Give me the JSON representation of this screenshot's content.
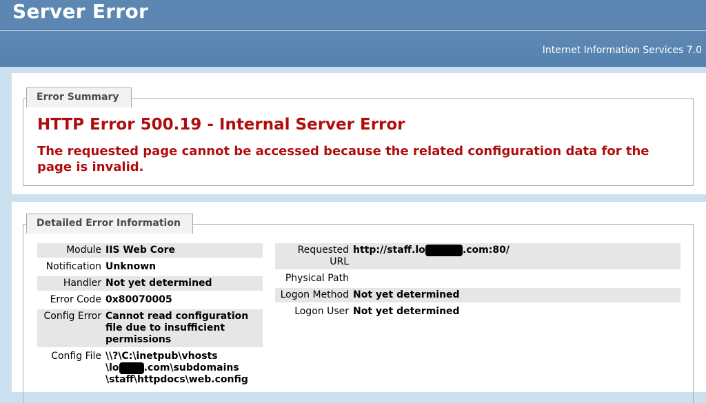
{
  "header": {
    "title": "Server Error",
    "product": "Internet Information Services 7.0"
  },
  "summary": {
    "tab_label": "Error Summary",
    "error_title": "HTTP Error 500.19 - Internal Server Error",
    "error_description": "The requested page cannot be accessed because the related configuration data for the page is invalid."
  },
  "detail": {
    "tab_label": "Detailed Error Information",
    "left": [
      {
        "key": "Module",
        "value": "IIS Web Core"
      },
      {
        "key": "Notification",
        "value": "Unknown"
      },
      {
        "key": "Handler",
        "value": "Not yet determined"
      },
      {
        "key": "Error Code",
        "value": "0x80070005"
      },
      {
        "key": "Config Error",
        "value": "Cannot read configuration file due to insufficient permissions"
      },
      {
        "key": "Config File",
        "value_parts": [
          "\\\\?\\C:\\inetpub\\vhosts",
          "\\lo",
          ".com\\subdomains",
          "\\staff\\httpdocs\\web.config"
        ]
      }
    ],
    "right": [
      {
        "key": "Requested URL",
        "value_parts": [
          "http://staff.lo",
          ".com:80/"
        ]
      },
      {
        "key": "Physical Path",
        "value": ""
      },
      {
        "key": "Logon Method",
        "value": "Not yet determined"
      },
      {
        "key": "Logon User",
        "value": "Not yet determined"
      }
    ]
  }
}
